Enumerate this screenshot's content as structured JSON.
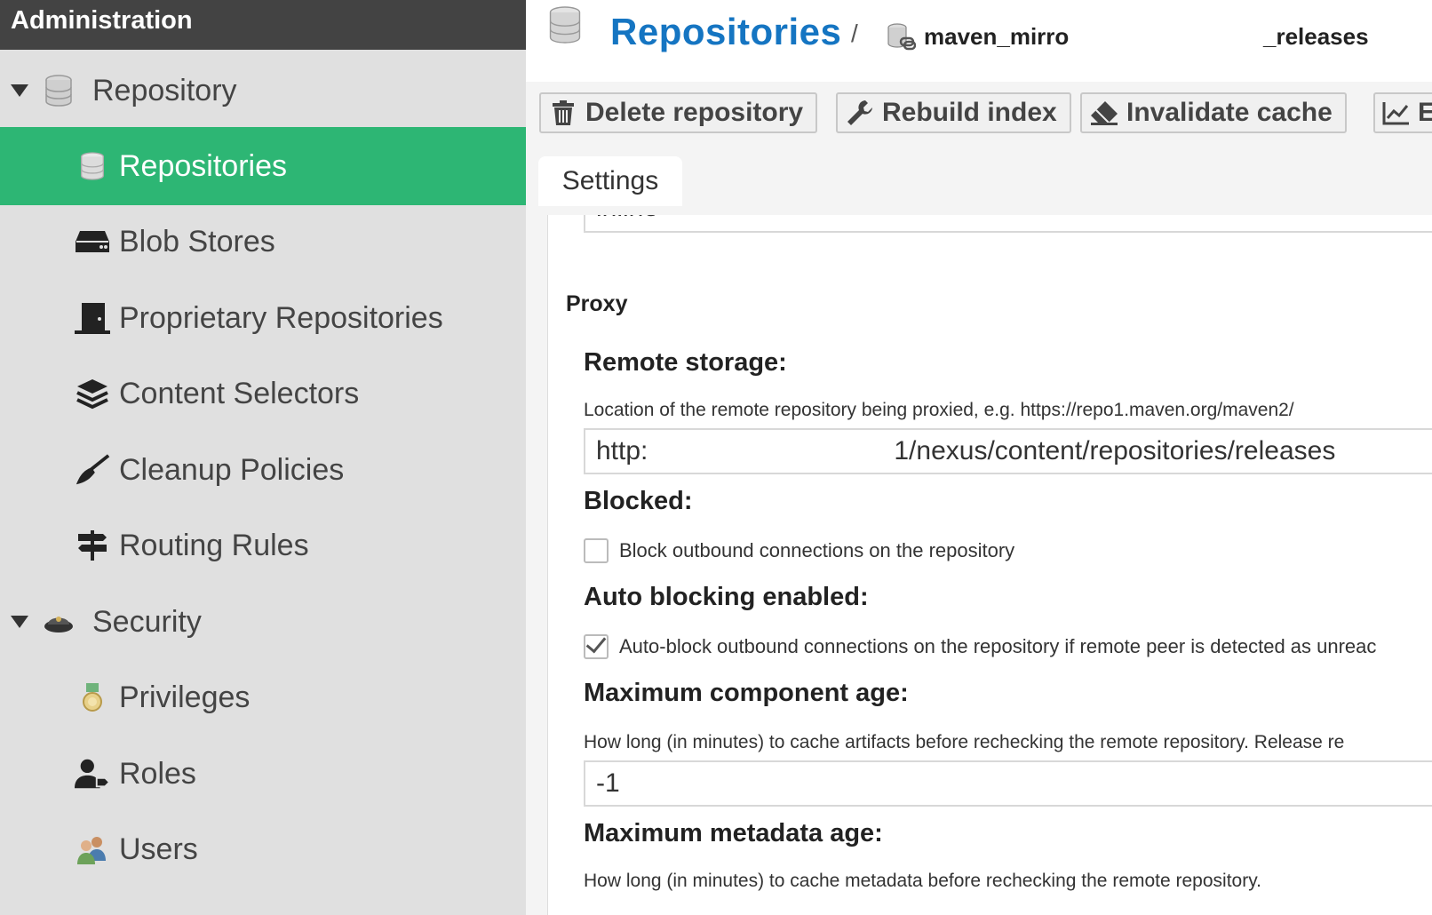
{
  "sidebar": {
    "title": "Administration",
    "groups": [
      {
        "label": "Repository",
        "icon": "database-icon"
      },
      {
        "label": "Security",
        "icon": "police-hat-icon"
      }
    ],
    "items": [
      {
        "label": "Repositories",
        "icon": "database-icon",
        "active": true
      },
      {
        "label": "Blob Stores",
        "icon": "hard-drive-icon"
      },
      {
        "label": "Proprietary Repositories",
        "icon": "door-icon"
      },
      {
        "label": "Content Selectors",
        "icon": "layers-icon"
      },
      {
        "label": "Cleanup Policies",
        "icon": "broom-icon"
      },
      {
        "label": "Routing Rules",
        "icon": "signpost-icon"
      },
      {
        "label": "Privileges",
        "icon": "medal-icon"
      },
      {
        "label": "Roles",
        "icon": "user-tag-icon"
      },
      {
        "label": "Users",
        "icon": "users-icon"
      }
    ]
  },
  "header": {
    "title": "Repositories",
    "separator": "/",
    "repo_name_prefix": "maven_mirro",
    "repo_name_suffix": "_releases"
  },
  "toolbar": {
    "delete_label": "Delete repository",
    "rebuild_label": "Rebuild index",
    "invalidate_label": "Invalidate cache",
    "next_label": "E"
  },
  "tabs": {
    "settings": "Settings"
  },
  "form": {
    "previous_value": "inline",
    "proxy_section": "Proxy",
    "remote_storage_label": "Remote storage:",
    "remote_storage_help": "Location of the remote repository being proxied, e.g. https://repo1.maven.org/maven2/",
    "remote_storage_prefix": "http:",
    "remote_storage_suffix": "1/nexus/content/repositories/releases",
    "blocked_label": "Blocked:",
    "blocked_checkbox_label": "Block outbound connections on the repository",
    "blocked_checked": false,
    "auto_blocking_label": "Auto blocking enabled:",
    "auto_blocking_checkbox_label": "Auto-block outbound connections on the repository if remote peer is detected as unreac",
    "auto_blocking_checked": true,
    "max_component_age_label": "Maximum component age:",
    "max_component_age_help": "How long (in minutes) to cache artifacts before rechecking the remote repository. Release re",
    "max_component_age_value": "-1",
    "max_metadata_age_label": "Maximum metadata age:",
    "max_metadata_age_help": "How long (in minutes) to cache metadata before rechecking the remote repository."
  },
  "colors": {
    "accent_green": "#2db674",
    "title_blue": "#1575c2",
    "sidebar_header": "#434343"
  }
}
